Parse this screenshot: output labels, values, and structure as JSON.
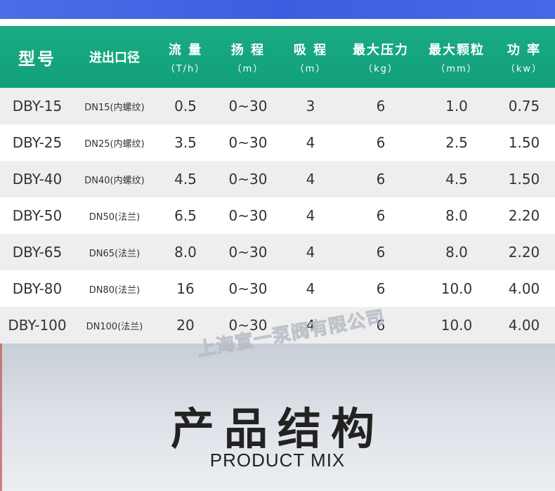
{
  "table": {
    "headers": [
      {
        "label": "型号",
        "unit": ""
      },
      {
        "label": "进出口径",
        "unit": ""
      },
      {
        "label": "流 量",
        "unit": "（T/h）"
      },
      {
        "label": "扬 程",
        "unit": "（m）"
      },
      {
        "label": "吸 程",
        "unit": "（m）"
      },
      {
        "label": "最大压力",
        "unit": "（kg）"
      },
      {
        "label": "最大颗粒",
        "unit": "（mm）"
      },
      {
        "label": "功 率",
        "unit": "（kw）"
      }
    ],
    "rows": [
      [
        "DBY-15",
        "DN15(内螺纹)",
        "0.5",
        "0~30",
        "3",
        "6",
        "1.0",
        "0.75"
      ],
      [
        "DBY-25",
        "DN25(内螺纹)",
        "3.5",
        "0~30",
        "4",
        "6",
        "2.5",
        "1.50"
      ],
      [
        "DBY-40",
        "DN40(内螺纹)",
        "4.5",
        "0~30",
        "4",
        "6",
        "4.5",
        "1.50"
      ],
      [
        "DBY-50",
        "DN50(法兰)",
        "6.5",
        "0~30",
        "4",
        "6",
        "8.0",
        "2.20"
      ],
      [
        "DBY-65",
        "DN65(法兰)",
        "8.0",
        "0~30",
        "4",
        "6",
        "8.0",
        "2.20"
      ],
      [
        "DBY-80",
        "DN80(法兰)",
        "16",
        "0~30",
        "4",
        "6",
        "10.0",
        "4.00"
      ],
      [
        "DBY-100",
        "DN100(法兰)",
        "20",
        "0~30",
        "4",
        "6",
        "10.0",
        "4.00"
      ]
    ]
  },
  "watermark": "上海宣一泵阀有限公司",
  "section": {
    "title": "产品结构",
    "subtitle": "PRODUCT MIX"
  },
  "colors": {
    "top_band": "#4a6ee8",
    "header_bg": "#1bab82",
    "alt_row": "#eeeeee"
  }
}
